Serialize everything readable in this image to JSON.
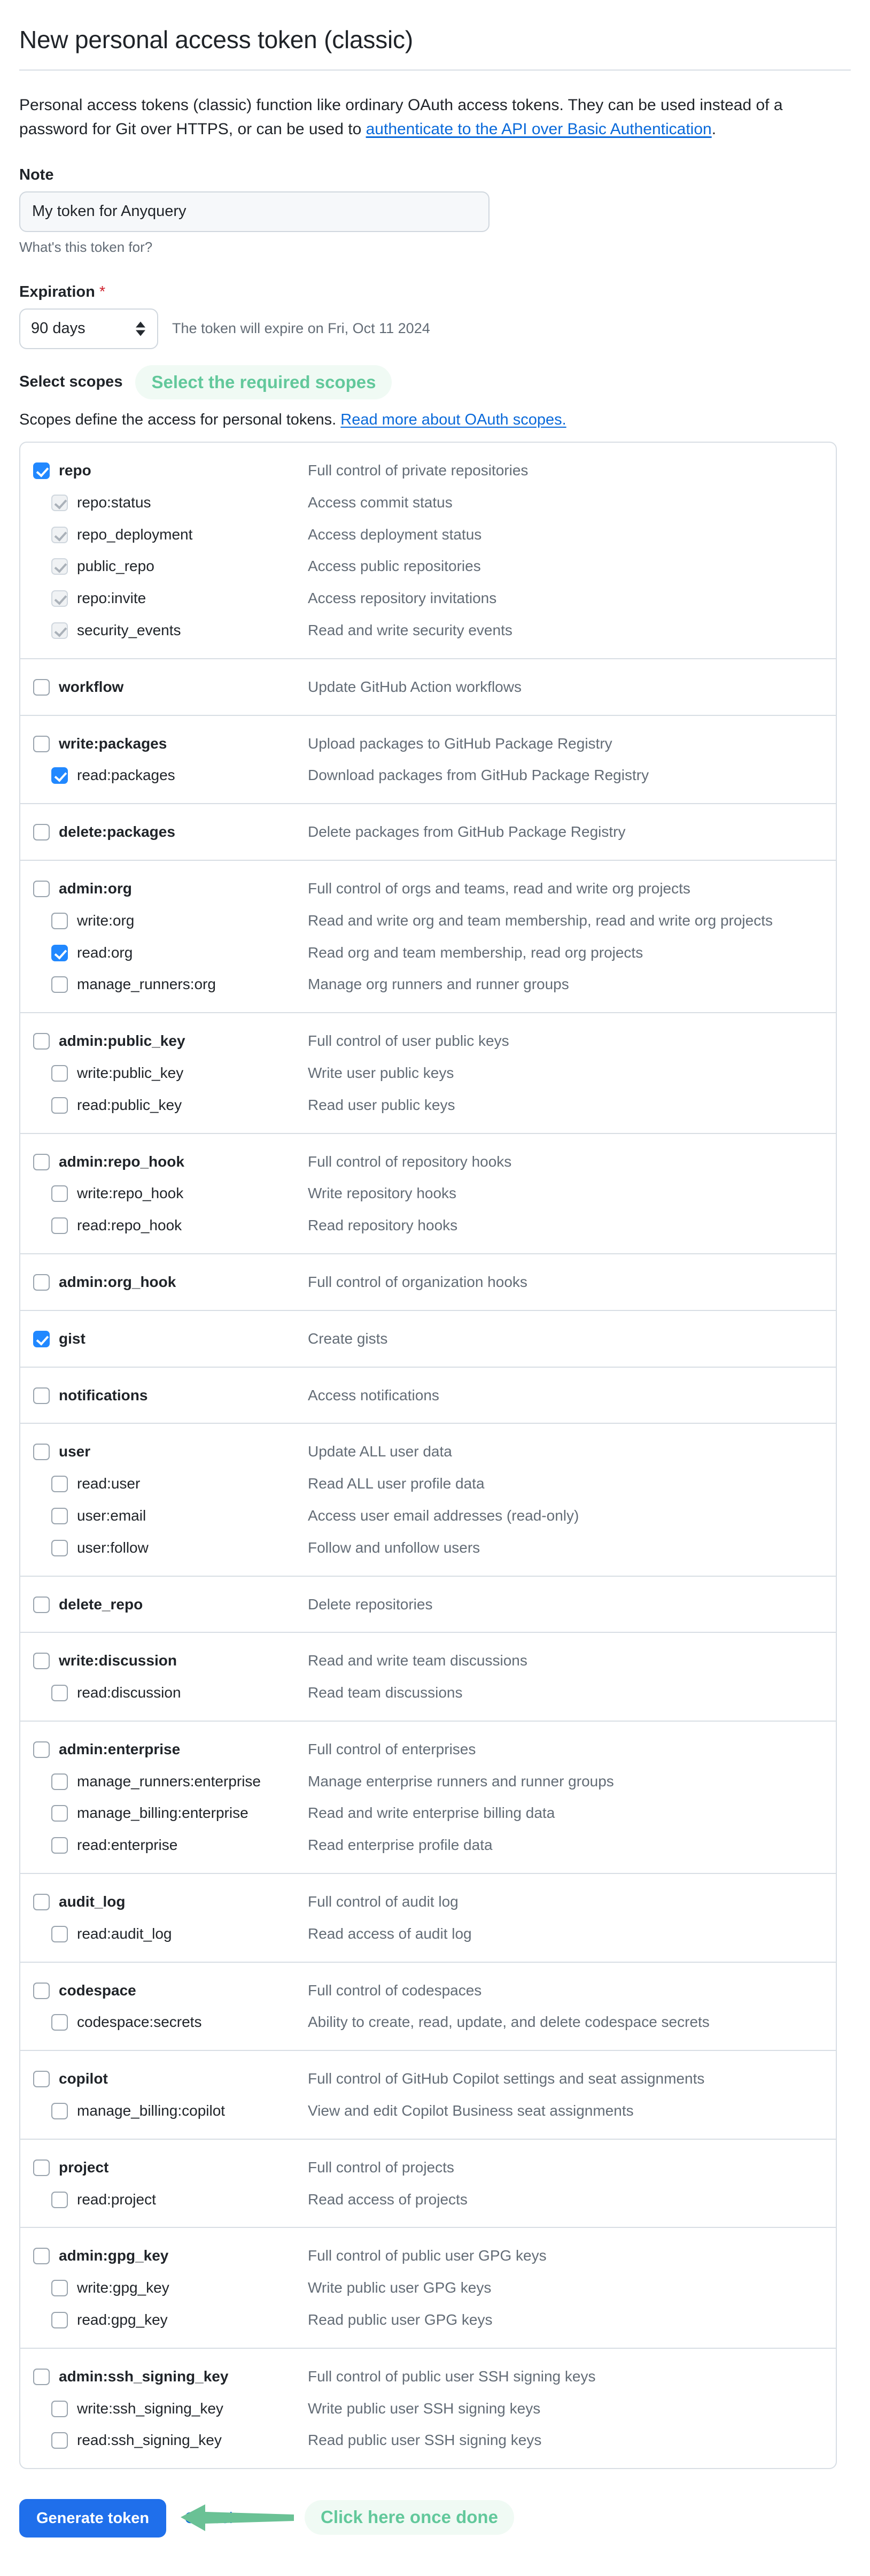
{
  "header": {
    "title": "New personal access token (classic)",
    "intro_before": "Personal access tokens (classic) function like ordinary OAuth access tokens. They can be used instead of a password for Git over HTTPS, or can be used to ",
    "intro_link": "authenticate to the API over Basic Authentication",
    "intro_after": "."
  },
  "note": {
    "label": "Note",
    "value": "My token for Anyquery",
    "placeholder": "What's this token for?",
    "helper": "What's this token for?"
  },
  "expiration": {
    "label": "Expiration",
    "required_mark": "*",
    "selected": "90 days",
    "note": "The token will expire on Fri, Oct 11 2024"
  },
  "scopes_header": {
    "label": "Select scopes",
    "annotation": "Select the required scopes",
    "desc_before": "Scopes define the access for personal tokens. ",
    "desc_link": "Read more about OAuth scopes."
  },
  "colors": {
    "accent_blue": "#1f6feb",
    "link_blue": "#0969da",
    "checkbox_blue": "#2188ff",
    "annotation_green": "#62c89b",
    "annotation_bg": "#f0faf4",
    "required_red": "#cf222e",
    "muted_text": "#636c76",
    "border": "#d8dee4"
  },
  "footer": {
    "generate_label": "Generate token",
    "cancel_label": "Cancel",
    "annotation": "Click here once done",
    "arrow_icon": "left-arrow-icon"
  },
  "scope_groups": [
    {
      "rows": [
        {
          "level": "parent",
          "name": "repo",
          "desc": "Full control of private repositories",
          "state": "checked"
        },
        {
          "level": "child",
          "name": "repo:status",
          "desc": "Access commit status",
          "state": "disabled-checked"
        },
        {
          "level": "child",
          "name": "repo_deployment",
          "desc": "Access deployment status",
          "state": "disabled-checked"
        },
        {
          "level": "child",
          "name": "public_repo",
          "desc": "Access public repositories",
          "state": "disabled-checked"
        },
        {
          "level": "child",
          "name": "repo:invite",
          "desc": "Access repository invitations",
          "state": "disabled-checked"
        },
        {
          "level": "child",
          "name": "security_events",
          "desc": "Read and write security events",
          "state": "disabled-checked"
        }
      ]
    },
    {
      "rows": [
        {
          "level": "parent",
          "name": "workflow",
          "desc": "Update GitHub Action workflows",
          "state": "unchecked"
        }
      ]
    },
    {
      "rows": [
        {
          "level": "parent",
          "name": "write:packages",
          "desc": "Upload packages to GitHub Package Registry",
          "state": "unchecked"
        },
        {
          "level": "child",
          "name": "read:packages",
          "desc": "Download packages from GitHub Package Registry",
          "state": "checked"
        }
      ]
    },
    {
      "rows": [
        {
          "level": "parent",
          "name": "delete:packages",
          "desc": "Delete packages from GitHub Package Registry",
          "state": "unchecked"
        }
      ]
    },
    {
      "rows": [
        {
          "level": "parent",
          "name": "admin:org",
          "desc": "Full control of orgs and teams, read and write org projects",
          "state": "unchecked"
        },
        {
          "level": "child",
          "name": "write:org",
          "desc": "Read and write org and team membership, read and write org projects",
          "state": "unchecked"
        },
        {
          "level": "child",
          "name": "read:org",
          "desc": "Read org and team membership, read org projects",
          "state": "checked"
        },
        {
          "level": "child",
          "name": "manage_runners:org",
          "desc": "Manage org runners and runner groups",
          "state": "unchecked"
        }
      ]
    },
    {
      "rows": [
        {
          "level": "parent",
          "name": "admin:public_key",
          "desc": "Full control of user public keys",
          "state": "unchecked"
        },
        {
          "level": "child",
          "name": "write:public_key",
          "desc": "Write user public keys",
          "state": "unchecked"
        },
        {
          "level": "child",
          "name": "read:public_key",
          "desc": "Read user public keys",
          "state": "unchecked"
        }
      ]
    },
    {
      "rows": [
        {
          "level": "parent",
          "name": "admin:repo_hook",
          "desc": "Full control of repository hooks",
          "state": "unchecked"
        },
        {
          "level": "child",
          "name": "write:repo_hook",
          "desc": "Write repository hooks",
          "state": "unchecked"
        },
        {
          "level": "child",
          "name": "read:repo_hook",
          "desc": "Read repository hooks",
          "state": "unchecked"
        }
      ]
    },
    {
      "rows": [
        {
          "level": "parent",
          "name": "admin:org_hook",
          "desc": "Full control of organization hooks",
          "state": "unchecked"
        }
      ]
    },
    {
      "rows": [
        {
          "level": "parent",
          "name": "gist",
          "desc": "Create gists",
          "state": "checked"
        }
      ]
    },
    {
      "rows": [
        {
          "level": "parent",
          "name": "notifications",
          "desc": "Access notifications",
          "state": "unchecked"
        }
      ]
    },
    {
      "rows": [
        {
          "level": "parent",
          "name": "user",
          "desc": "Update ALL user data",
          "state": "unchecked"
        },
        {
          "level": "child",
          "name": "read:user",
          "desc": "Read ALL user profile data",
          "state": "unchecked"
        },
        {
          "level": "child",
          "name": "user:email",
          "desc": "Access user email addresses (read-only)",
          "state": "unchecked"
        },
        {
          "level": "child",
          "name": "user:follow",
          "desc": "Follow and unfollow users",
          "state": "unchecked"
        }
      ]
    },
    {
      "rows": [
        {
          "level": "parent",
          "name": "delete_repo",
          "desc": "Delete repositories",
          "state": "unchecked"
        }
      ]
    },
    {
      "rows": [
        {
          "level": "parent",
          "name": "write:discussion",
          "desc": "Read and write team discussions",
          "state": "unchecked"
        },
        {
          "level": "child",
          "name": "read:discussion",
          "desc": "Read team discussions",
          "state": "unchecked"
        }
      ]
    },
    {
      "rows": [
        {
          "level": "parent",
          "name": "admin:enterprise",
          "desc": "Full control of enterprises",
          "state": "unchecked"
        },
        {
          "level": "child",
          "name": "manage_runners:enterprise",
          "desc": "Manage enterprise runners and runner groups",
          "state": "unchecked"
        },
        {
          "level": "child",
          "name": "manage_billing:enterprise",
          "desc": "Read and write enterprise billing data",
          "state": "unchecked"
        },
        {
          "level": "child",
          "name": "read:enterprise",
          "desc": "Read enterprise profile data",
          "state": "unchecked"
        }
      ]
    },
    {
      "rows": [
        {
          "level": "parent",
          "name": "audit_log",
          "desc": "Full control of audit log",
          "state": "unchecked"
        },
        {
          "level": "child",
          "name": "read:audit_log",
          "desc": "Read access of audit log",
          "state": "unchecked"
        }
      ]
    },
    {
      "rows": [
        {
          "level": "parent",
          "name": "codespace",
          "desc": "Full control of codespaces",
          "state": "unchecked"
        },
        {
          "level": "child",
          "name": "codespace:secrets",
          "desc": "Ability to create, read, update, and delete codespace secrets",
          "state": "unchecked"
        }
      ]
    },
    {
      "rows": [
        {
          "level": "parent",
          "name": "copilot",
          "desc": "Full control of GitHub Copilot settings and seat assignments",
          "state": "unchecked"
        },
        {
          "level": "child",
          "name": "manage_billing:copilot",
          "desc": "View and edit Copilot Business seat assignments",
          "state": "unchecked"
        }
      ]
    },
    {
      "rows": [
        {
          "level": "parent",
          "name": "project",
          "desc": "Full control of projects",
          "state": "unchecked"
        },
        {
          "level": "child",
          "name": "read:project",
          "desc": "Read access of projects",
          "state": "unchecked"
        }
      ]
    },
    {
      "rows": [
        {
          "level": "parent",
          "name": "admin:gpg_key",
          "desc": "Full control of public user GPG keys",
          "state": "unchecked"
        },
        {
          "level": "child",
          "name": "write:gpg_key",
          "desc": "Write public user GPG keys",
          "state": "unchecked"
        },
        {
          "level": "child",
          "name": "read:gpg_key",
          "desc": "Read public user GPG keys",
          "state": "unchecked"
        }
      ]
    },
    {
      "rows": [
        {
          "level": "parent",
          "name": "admin:ssh_signing_key",
          "desc": "Full control of public user SSH signing keys",
          "state": "unchecked"
        },
        {
          "level": "child",
          "name": "write:ssh_signing_key",
          "desc": "Write public user SSH signing keys",
          "state": "unchecked"
        },
        {
          "level": "child",
          "name": "read:ssh_signing_key",
          "desc": "Read public user SSH signing keys",
          "state": "unchecked"
        }
      ]
    }
  ]
}
